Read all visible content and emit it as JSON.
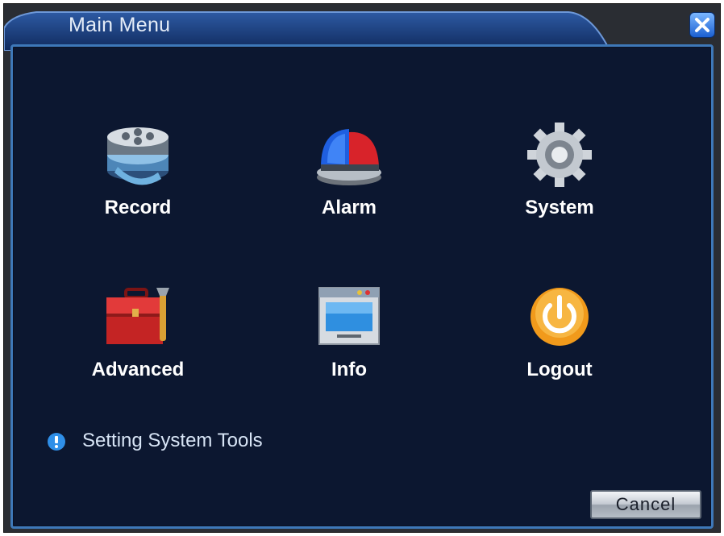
{
  "window": {
    "title": "Main Menu"
  },
  "menu": {
    "items": [
      {
        "label": "Record",
        "icon": "film-reel-icon"
      },
      {
        "label": "Alarm",
        "icon": "siren-icon"
      },
      {
        "label": "System",
        "icon": "gear-icon"
      },
      {
        "label": "Advanced",
        "icon": "toolbox-icon"
      },
      {
        "label": "Info",
        "icon": "info-window-icon"
      },
      {
        "label": "Logout",
        "icon": "power-icon"
      }
    ]
  },
  "status": {
    "text": "Setting System Tools",
    "icon": "info-icon"
  },
  "buttons": {
    "cancel": "Cancel",
    "close": "close-icon"
  },
  "colors": {
    "panel_bg": "#0c1730",
    "panel_border": "#3e78b8",
    "title_bar": "#1e3f78",
    "label_text": "#ffffff",
    "status_icon": "#2f8fe8"
  }
}
